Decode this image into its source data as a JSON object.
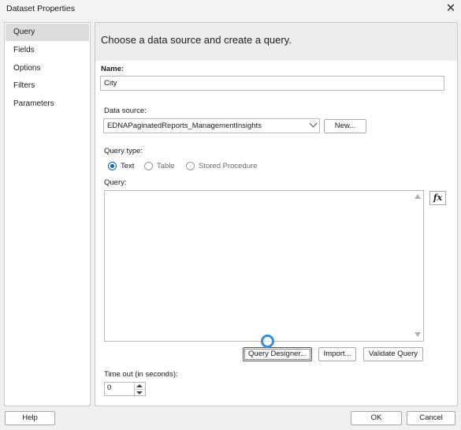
{
  "window": {
    "title": "Dataset Properties"
  },
  "nav": {
    "items": [
      "Query",
      "Fields",
      "Options",
      "Filters",
      "Parameters"
    ],
    "selected": "Query"
  },
  "header": {
    "text": "Choose a data source and create a query."
  },
  "name": {
    "label": "Name:",
    "value": "City"
  },
  "data_source": {
    "label": "Data source:",
    "value": "EDNAPaginatedReports_ManagementInsights",
    "new_button": "New..."
  },
  "query_type": {
    "label": "Query type:",
    "options": [
      {
        "label": "Text",
        "checked": true
      },
      {
        "label": "Table",
        "checked": false
      },
      {
        "label": "Stored Procedure",
        "checked": false
      }
    ]
  },
  "query": {
    "label": "Query:",
    "value": "",
    "fx_label": "fx"
  },
  "query_buttons": {
    "designer": "Query Designer...",
    "import": "Import...",
    "validate": "Validate Query"
  },
  "timeout": {
    "label": "Time out (in seconds):",
    "value": "0"
  },
  "footer": {
    "help": "Help",
    "ok": "OK",
    "cancel": "Cancel"
  },
  "colors": {
    "accent": "#0a62c4",
    "cursor_ring": "#2f8ee6"
  }
}
